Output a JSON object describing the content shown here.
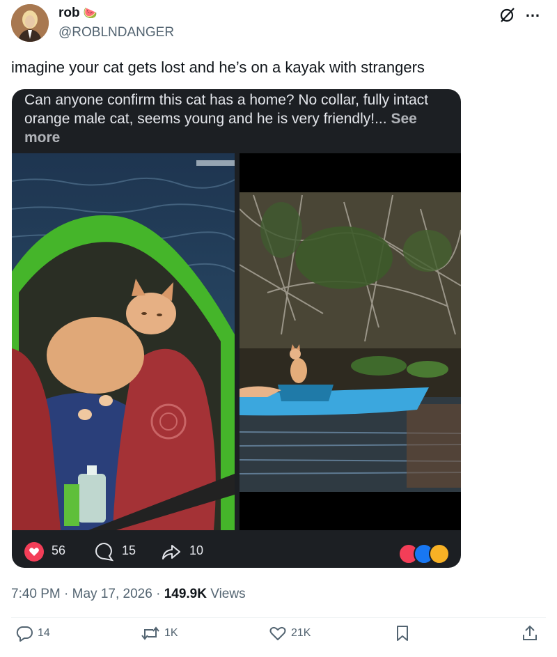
{
  "author": {
    "name": "rob",
    "emoji": "🍉",
    "handle": "@ROBLNDANGER"
  },
  "header_icons": {
    "grok": "grok-slash-icon",
    "more": "…"
  },
  "tweet": {
    "text": "imagine your cat gets lost and he’s on a kayak with strangers"
  },
  "embedded_post": {
    "text": "Can anyone confirm this cat has a home? No collar, fully intact orange male cat, seems young and he is very friendly!...",
    "see_more": "See more",
    "reactions_count": "56",
    "comments_count": "15",
    "shares_count": "10",
    "colors": {
      "background": "#1c1f23",
      "love": "#f33e58",
      "like": "#1877f2"
    }
  },
  "meta": {
    "time": "7:40 PM",
    "separator": "·",
    "date": "May 17, 2026",
    "views_count": "149.9K",
    "views_label": "Views"
  },
  "actions": {
    "replies": "14",
    "reposts": "1K",
    "likes": "21K"
  },
  "colors": {
    "text": "#0f1419",
    "muted": "#536471",
    "divider": "#eff3f4"
  }
}
